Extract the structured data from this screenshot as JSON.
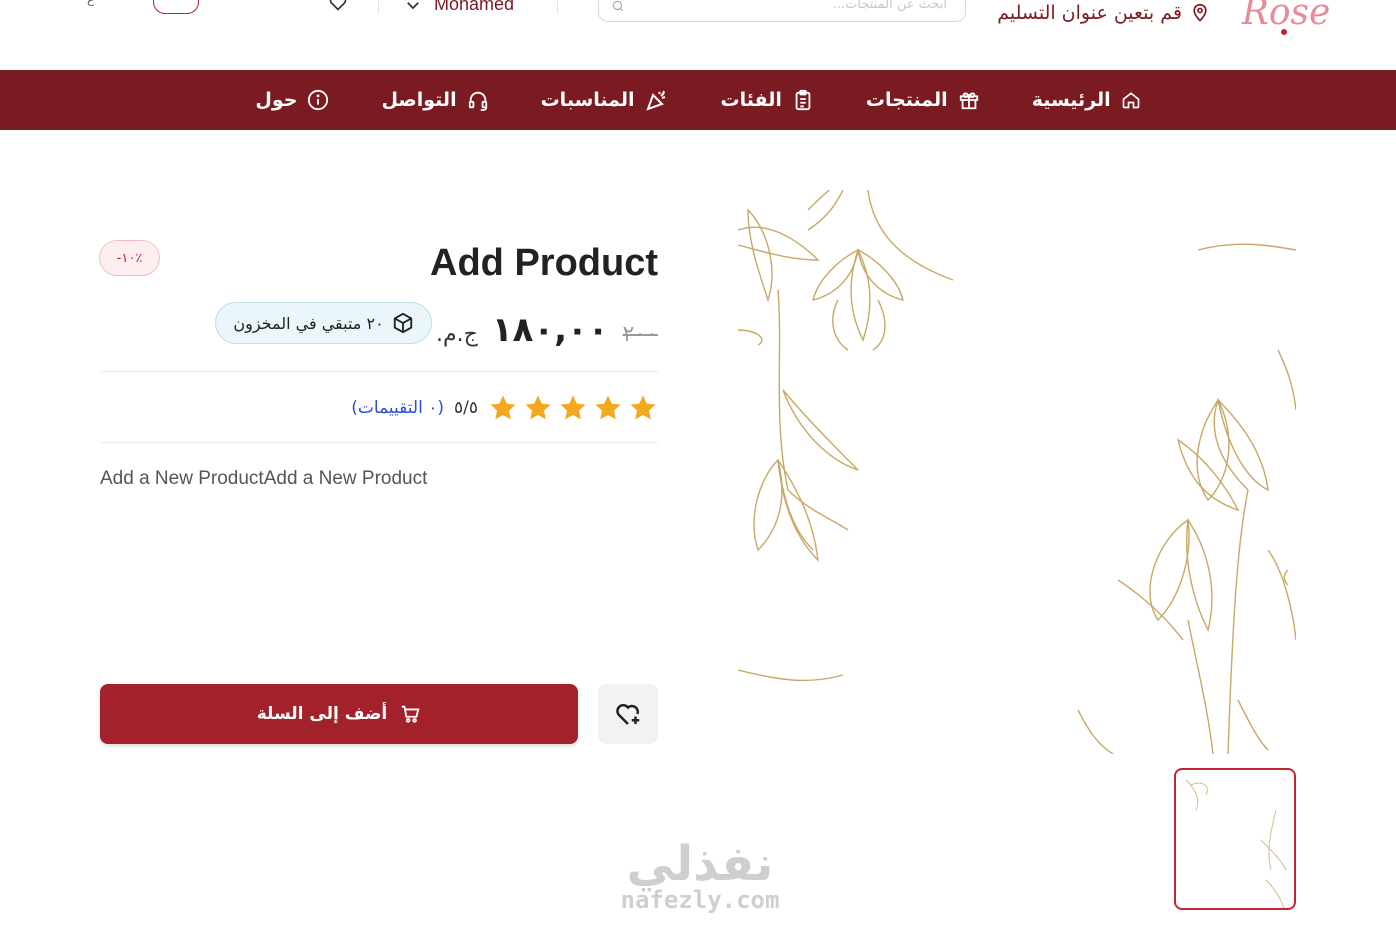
{
  "header": {
    "logo_text": "Rose",
    "delivery_label": "قم بتعين عنوان التسليم",
    "search_placeholder": "ابحث عن المنتجات...",
    "user_name": "Mohamed",
    "language_label": "ع"
  },
  "nav": {
    "items": [
      {
        "label": "الرئيسية",
        "icon": "home-icon"
      },
      {
        "label": "المنتجات",
        "icon": "gift-icon"
      },
      {
        "label": "الفئات",
        "icon": "clipboard-list-icon"
      },
      {
        "label": "المناسبات",
        "icon": "party-popper-icon"
      },
      {
        "label": "التواصل",
        "icon": "headset-icon"
      },
      {
        "label": "حول",
        "icon": "info-icon"
      }
    ]
  },
  "product": {
    "title": "Add Product",
    "discount_badge": "-١٠٪",
    "old_price": "٢٠٠",
    "price": "١٨٠,٠٠",
    "currency": "ج.م.",
    "stock_label": "٢٠ متبقي في المخزون",
    "rating": 5,
    "rating_text": "٥/٥",
    "reviews_text": "(٠ التقييمات)",
    "description": "Add a New ProductAdd a New Product",
    "add_to_cart_label": "أضف إلى السلة"
  },
  "watermark": {
    "arabic": "نفذلي",
    "latin": "nafezly.com"
  },
  "colors": {
    "brand": "#7a1b22",
    "button": "#a3212a",
    "star": "#f4a81d",
    "link": "#2b4fd3"
  }
}
